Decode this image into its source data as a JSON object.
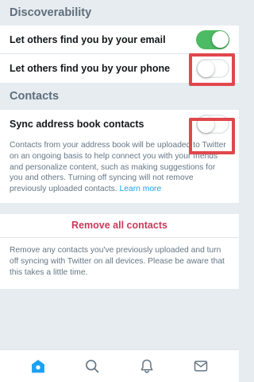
{
  "discoverability": {
    "header": "Discoverability",
    "email_label": "Let others find you by your email",
    "email_toggle": "on",
    "phone_label": "Let others find you by your phone",
    "phone_toggle": "off"
  },
  "contacts": {
    "header": "Contacts",
    "sync_label": "Sync address book contacts",
    "sync_toggle": "off",
    "description": "Contacts from your address book will be uploaded to Twitter on an ongoing basis to help connect you with your friends and personalize content, such as making suggestions for you and others. Turning off syncing will not remove previously uploaded contacts.",
    "learn_more": "Learn more"
  },
  "remove": {
    "label": "Remove all contacts",
    "description": "Remove any contacts you've previously uploaded and turn off syncing with Twitter on all devices. Please be aware that this takes a little time."
  },
  "tabbar": {
    "items": [
      {
        "icon": "home-icon",
        "active": true
      },
      {
        "icon": "search-icon",
        "active": false
      },
      {
        "icon": "bell-icon",
        "active": false
      },
      {
        "icon": "mail-icon",
        "active": false
      }
    ]
  },
  "colors": {
    "toggle_on": "#4cbb63",
    "highlight": "#e0474c",
    "link": "#1da1f2",
    "destructive": "#c93a5a",
    "tab_active": "#1da1f2",
    "tab_inactive": "#657786"
  }
}
